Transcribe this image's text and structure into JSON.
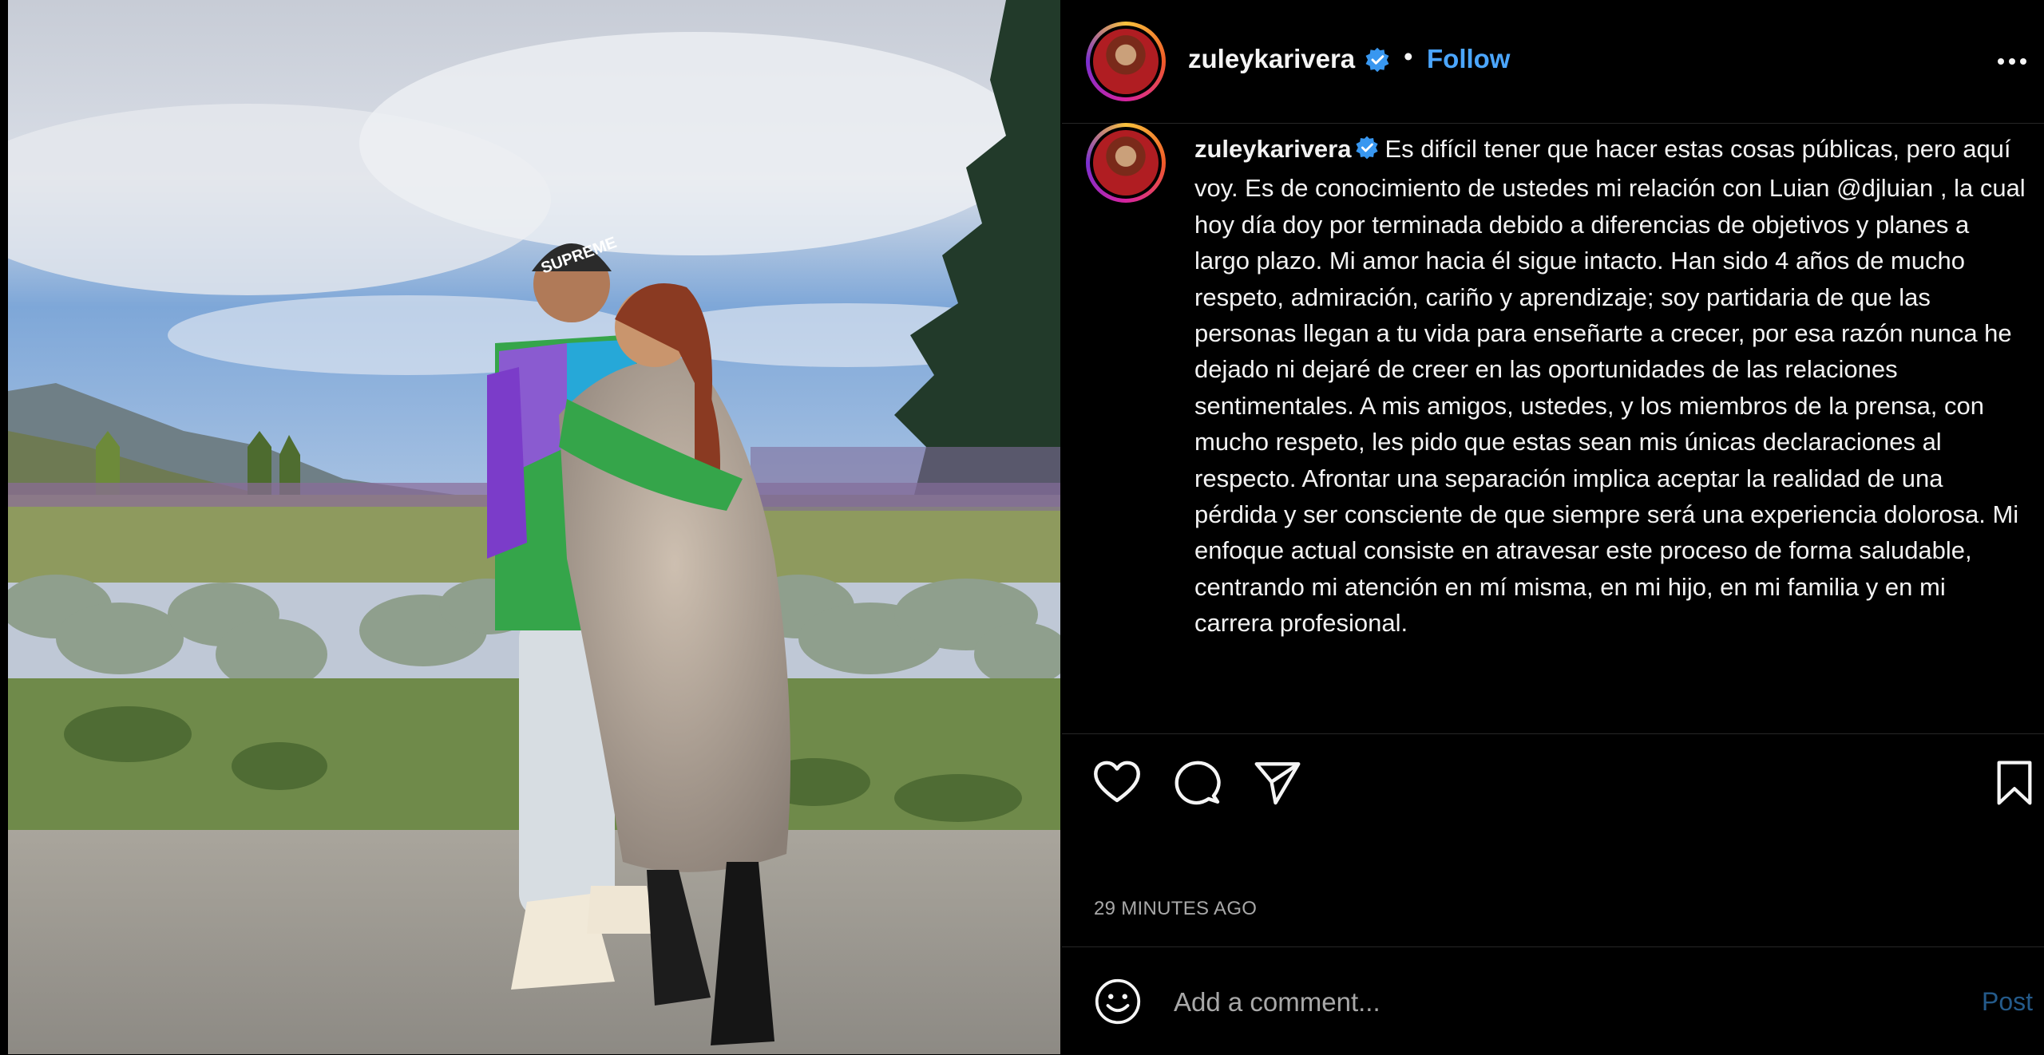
{
  "post": {
    "username": "zuleykarivera",
    "separator": "•",
    "follow_label": "Follow",
    "caption_text": "Es difícil tener que hacer estas cosas públicas, pero aquí voy. Es de conocimiento de ustedes mi relación con Luian @djluian , la cual hoy día doy por terminada debido a diferencias de objetivos y planes a largo plazo. Mi amor hacia él sigue intacto. Han sido 4 años de mucho respeto, admiración, cariño y aprendizaje; soy partidaria de que las personas llegan a tu vida para enseñarte a crecer, por esa razón nunca he dejado ni dejaré de creer en las oportunidades de las relaciones sentimentales. A mis amigos, ustedes, y los miembros de la prensa, con mucho respeto, les pido que estas sean mis únicas declaraciones al respecto. Afrontar una separación implica aceptar la realidad de una pérdida y ser consciente de que siempre será una experiencia dolorosa. Mi enfoque actual consiste en atravesar este proceso de forma saludable, centrando mi atención en mí misma, en mi hijo, en mi familia y en mi carrera profesional.",
    "timestamp": "29 MINUTES AGO",
    "photo_hat_text": "SUPREME"
  },
  "comment": {
    "placeholder": "Add a comment...",
    "post_label": "Post"
  },
  "icons": {
    "verified": "verified-badge-icon",
    "more": "more-options-icon",
    "like": "heart-icon",
    "comment": "comment-bubble-icon",
    "share": "paper-plane-icon",
    "save": "bookmark-icon",
    "emoji": "emoji-smiley-icon"
  },
  "colors": {
    "background": "#000000",
    "follow_link": "#4ba6ff",
    "verified_badge": "#3897f0",
    "muted_text": "#a8a8a8",
    "post_disabled": "#245a8a"
  }
}
